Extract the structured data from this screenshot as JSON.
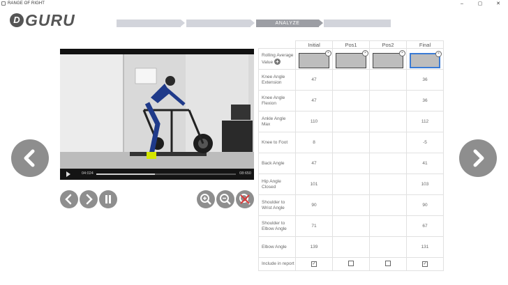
{
  "window": {
    "title": "RANGE OF RIGHT",
    "min": "–",
    "max": "▢",
    "close": "✕"
  },
  "logo": {
    "mark": "D",
    "word": "GURU"
  },
  "steps": [
    "",
    "",
    "ANALYZE",
    ""
  ],
  "video": {
    "time_current": "04:024",
    "time_total": "08:650",
    "progress": 0.42
  },
  "table": {
    "columns": [
      "Initial",
      "Pos1",
      "Pos2",
      "Final"
    ],
    "rolling_label": "Rolling Average Value",
    "rows": [
      {
        "label": "Knee Angle Extension",
        "values": [
          "47",
          "",
          "",
          "36"
        ]
      },
      {
        "label": "Knee Angle Flexion",
        "values": [
          "47",
          "",
          "",
          "36"
        ]
      },
      {
        "label": "Ankle Angle Max",
        "values": [
          "110",
          "",
          "",
          "112"
        ]
      },
      {
        "label": "Knee to Foot",
        "values": [
          "8",
          "",
          "",
          "-5"
        ]
      },
      {
        "label": "Back Angle",
        "values": [
          "47",
          "",
          "",
          "41"
        ]
      },
      {
        "label": "Hip Angle Closed",
        "values": [
          "101",
          "",
          "",
          "103"
        ]
      },
      {
        "label": "Shoulder to Wrist Angle",
        "values": [
          "90",
          "",
          "",
          "90"
        ]
      },
      {
        "label": "Shoulder to Elbow Angle",
        "values": [
          "71",
          "",
          "",
          "67"
        ]
      },
      {
        "label": "Elbow Angle",
        "values": [
          "139",
          "",
          "",
          "131"
        ]
      }
    ],
    "include_label": "Include in report",
    "include": [
      true,
      false,
      false,
      true
    ]
  },
  "colors": {
    "accent": "#8e8e8e",
    "step_active": "#9c9ea4",
    "step": "#d2d4db"
  }
}
